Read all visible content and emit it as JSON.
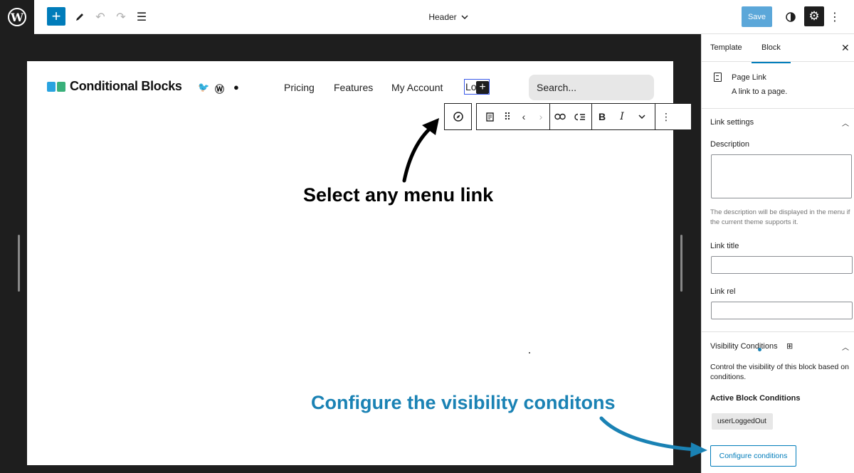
{
  "topbar": {
    "document_title": "Header",
    "save_label": "Save"
  },
  "canvas": {
    "site_title": "Conditional Blocks",
    "nav": [
      "Pricing",
      "Features",
      "My Account",
      "Lo"
    ],
    "search_placeholder": "Search..."
  },
  "annotations": {
    "select_hint": "Select any menu link",
    "configure_hint": "Configure the visibility conditons"
  },
  "sidebar": {
    "tabs": [
      "Template",
      "Block"
    ],
    "active_tab": "Block",
    "block_title": "Page Link",
    "block_description": "A link to a page.",
    "link_settings": {
      "heading": "Link settings",
      "description_label": "Description",
      "description_value": "",
      "description_help": "The description will be displayed in the menu if the current theme supports it.",
      "link_title_label": "Link title",
      "link_title_value": "",
      "link_rel_label": "Link rel",
      "link_rel_value": ""
    },
    "visibility": {
      "heading": "Visibility Conditions",
      "description": "Control the visibility of this block based on conditions.",
      "active_heading": "Active Block Conditions",
      "conditions": [
        "userLoggedOut"
      ],
      "configure_label": "Configure conditions"
    }
  },
  "colors": {
    "accent": "#007cba",
    "annotation_blue": "#1a82b4",
    "editor_dark": "#1e1e1e"
  }
}
